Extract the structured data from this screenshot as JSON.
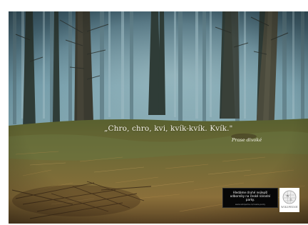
{
  "poster": {
    "quote": "„Chro, chro, kvi, kvík-kvík. Kvík.\"",
    "author": "Prase divoké",
    "info_text": "Hledáme druhé nejlepší odborníky na české národní parky.",
    "info_url": "www.wikipedie.cz/ceske-parky",
    "logo_label": "WIKIPEDIE"
  }
}
